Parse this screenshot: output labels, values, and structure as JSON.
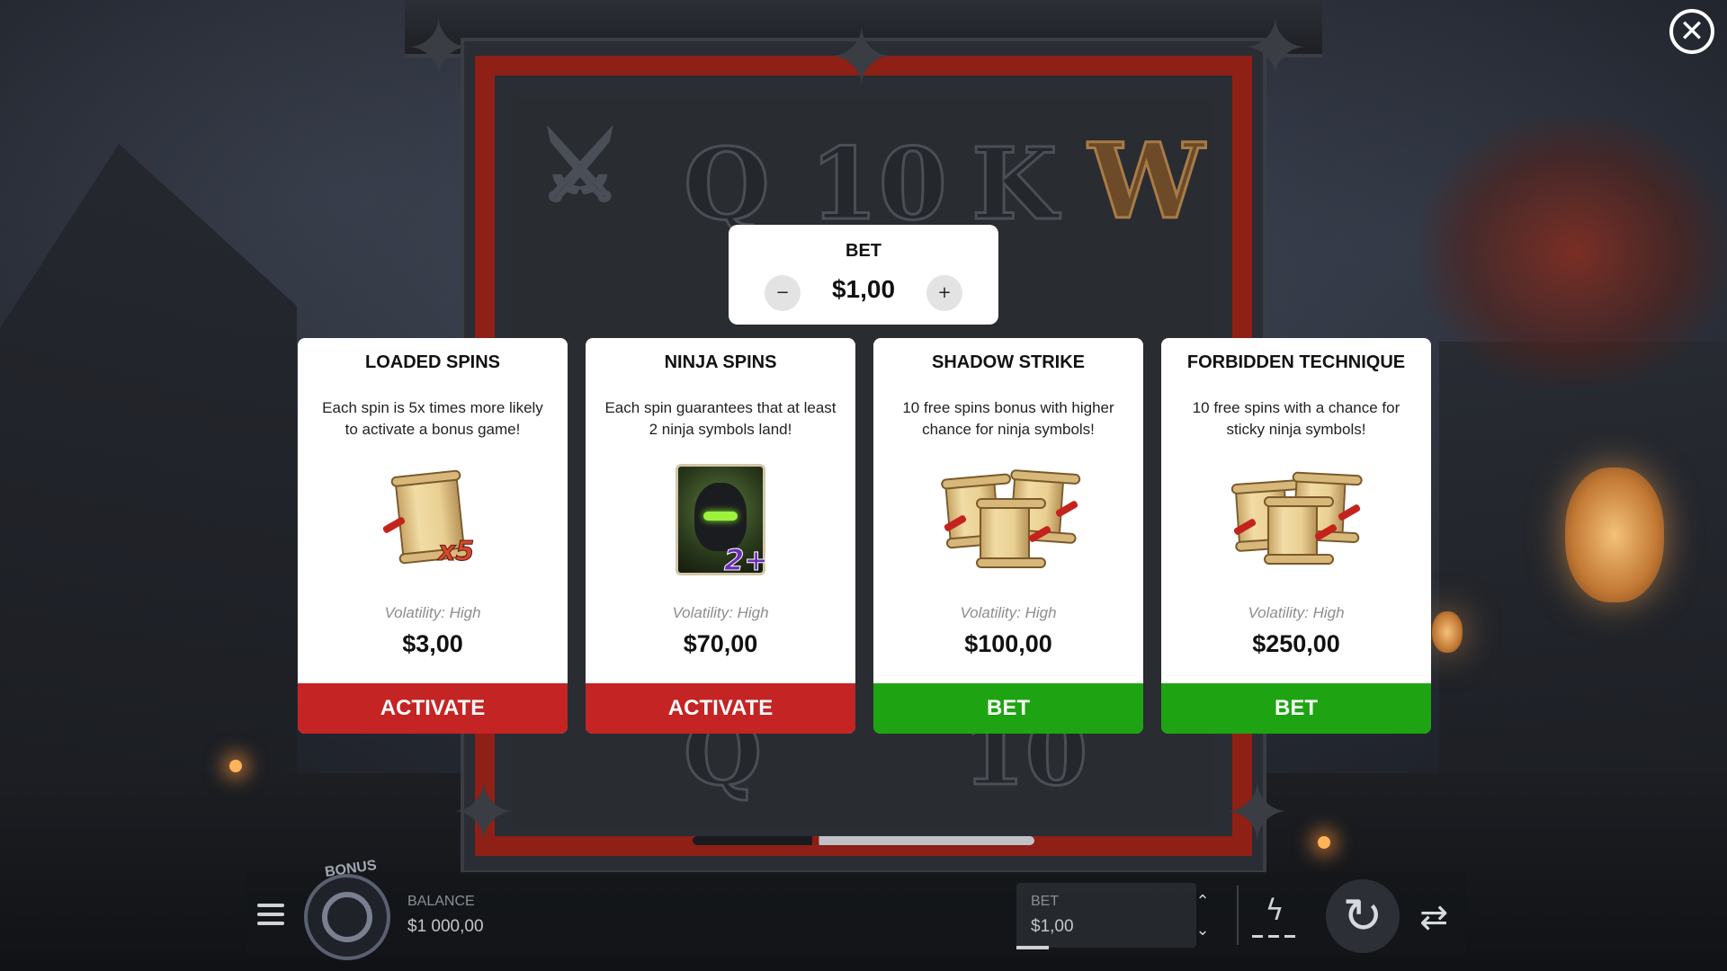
{
  "close": {
    "icon": "close-icon",
    "glyph": "✕"
  },
  "reels": {
    "top_row": [
      "Q",
      "10",
      "K",
      "W"
    ],
    "bottom_row": [
      "Q",
      "10"
    ]
  },
  "bet_panel": {
    "title": "BET",
    "value": "$1,00",
    "minus": "−",
    "plus": "+"
  },
  "cards": [
    {
      "title": "LOADED SPINS",
      "description": "Each spin is 5x times more likely to activate a bonus game!",
      "art_icon": "scroll-x5-icon",
      "badge": "x5",
      "volatility": "Volatility: High",
      "price": "$3,00",
      "button": "ACTIVATE",
      "button_color": "#c42424"
    },
    {
      "title": "NINJA SPINS",
      "description": "Each spin guarantees that at least 2 ninja symbols land!",
      "art_icon": "ninja-2plus-icon",
      "badge": "2+",
      "volatility": "Volatility: High",
      "price": "$70,00",
      "button": "ACTIVATE",
      "button_color": "#c42424"
    },
    {
      "title": "SHADOW STRIKE",
      "description": "10 free spins bonus with higher chance for ninja symbols!",
      "art_icon": "triple-scroll-icon",
      "volatility": "Volatility: High",
      "price": "$100,00",
      "button": "BET",
      "button_color": "#1ea312"
    },
    {
      "title": "FORBIDDEN TECHNIQUE",
      "description": "10 free spins with a chance for sticky ninja symbols!",
      "art_icon": "triple-scroll-icon",
      "volatility": "Volatility: High",
      "price": "$250,00",
      "button": "BET",
      "button_color": "#1ea312"
    }
  ],
  "bottom_bar": {
    "bonus_label": "BONUS",
    "balance_label": "BALANCE",
    "balance_value": "$1 000,00",
    "bet_label": "BET",
    "bet_value": "$1,00",
    "icons": [
      "menu-icon",
      "bonus-wheel-icon",
      "chevron-up-icon",
      "chevron-down-icon",
      "lightning-icon",
      "spin-icon",
      "autoplay-icon"
    ]
  }
}
